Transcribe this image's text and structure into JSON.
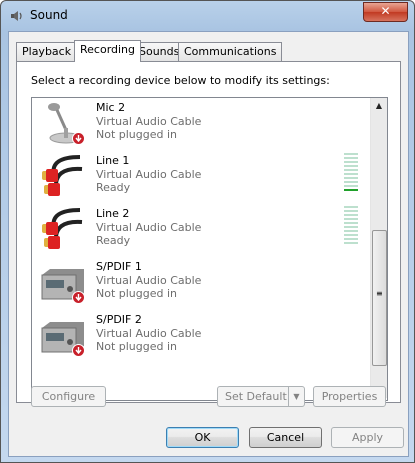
{
  "window": {
    "title": "Sound",
    "close_glyph": "✕"
  },
  "tabs": [
    {
      "label": "Playback",
      "active": false
    },
    {
      "label": "Recording",
      "active": true
    },
    {
      "label": "Sounds",
      "active": false
    },
    {
      "label": "Communications",
      "active": false
    }
  ],
  "instructions": "Select a recording device below to modify its settings:",
  "devices": [
    {
      "name": "Mic 2",
      "description": "Virtual Audio Cable",
      "status": "Not plugged in",
      "icon": "microphone-icon",
      "meter": false
    },
    {
      "name": "Line 1",
      "description": "Virtual Audio Cable",
      "status": "Ready",
      "icon": "rca-cable-icon",
      "meter": true,
      "meter_level": 0.1
    },
    {
      "name": "Line 2",
      "description": "Virtual Audio Cable",
      "status": "Ready",
      "icon": "rca-cable-icon",
      "meter": true,
      "meter_level": 0
    },
    {
      "name": "S/PDIF 1",
      "description": "Virtual Audio Cable",
      "status": "Not plugged in",
      "icon": "spdif-device-icon",
      "meter": false
    },
    {
      "name": "S/PDIF 2",
      "description": "Virtual Audio Cable",
      "status": "Not plugged in",
      "icon": "spdif-device-icon",
      "meter": false
    }
  ],
  "list_buttons": {
    "configure": "Configure",
    "set_default": "Set Default",
    "properties": "Properties"
  },
  "dialog_buttons": {
    "ok": "OK",
    "cancel": "Cancel",
    "apply": "Apply"
  },
  "scroll": {
    "position": 0.75
  },
  "colors": {
    "meter_idle": "#bde0ce",
    "meter_active": "#1fa02a",
    "unplugged_badge": "#c8202a",
    "close_button": "#c13a22"
  }
}
